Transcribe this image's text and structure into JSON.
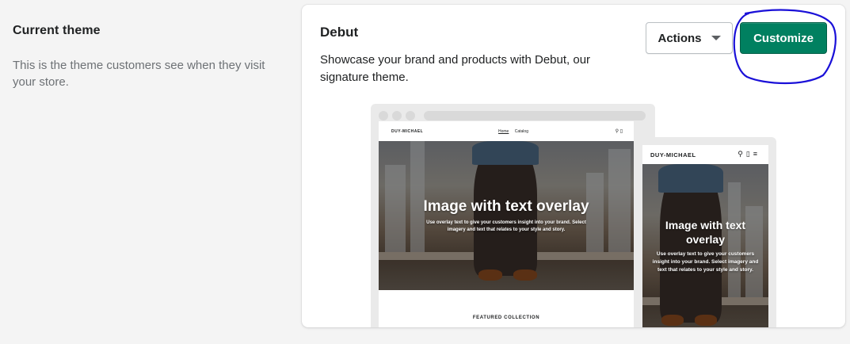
{
  "section": {
    "title": "Current theme",
    "description": "This is the theme customers see when they visit your store."
  },
  "theme": {
    "name": "Debut",
    "description": "Showcase your brand and products with Debut, our signature theme."
  },
  "actions": {
    "actions_label": "Actions",
    "customize_label": "Customize",
    "caret_icon": "chevron-down-icon"
  },
  "colors": {
    "primary": "#008060",
    "annotation": "#1a10d8",
    "background": "#f4f4f4",
    "card": "#ffffff"
  },
  "preview": {
    "desktop": {
      "logo": "DUY-MICHAEL",
      "nav_links": [
        "Home",
        "Catalog"
      ],
      "hero_title": "Image with text overlay",
      "hero_sub": "Use overlay text to give your customers insight into your brand. Select imagery and text that relates to your style and story.",
      "featured": "FEATURED COLLECTION"
    },
    "mobile": {
      "logo": "DUY-MICHAEL",
      "hero_title": "Image with text overlay",
      "hero_sub": "Use overlay text to give your customers insight into your brand. Select imagery and text that relates to your style and story."
    }
  }
}
